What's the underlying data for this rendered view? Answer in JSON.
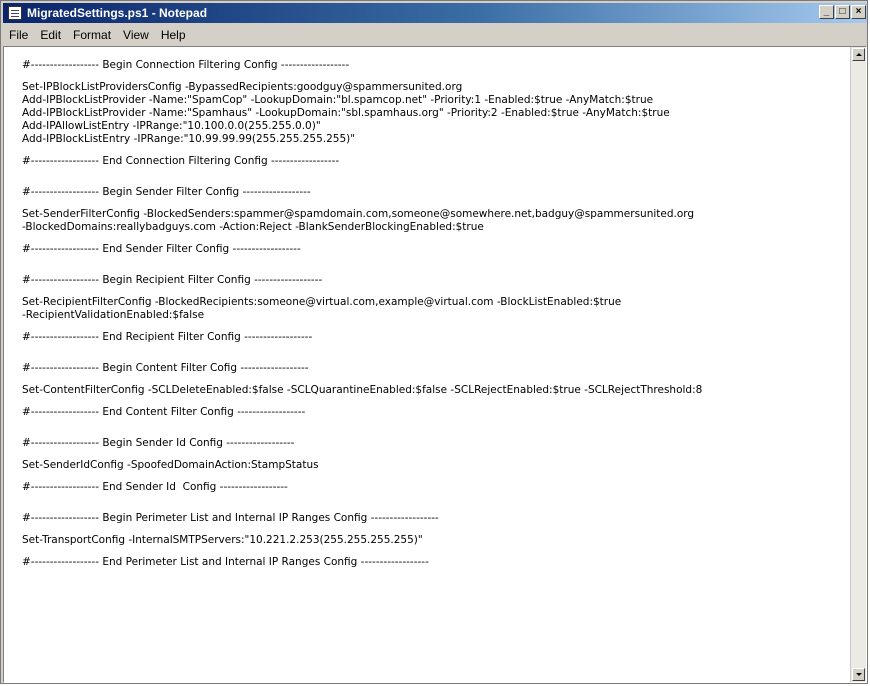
{
  "window": {
    "title": "MigratedSettings.ps1 - Notepad",
    "controls": {
      "minimize": "_",
      "maximize": "□",
      "close": "×"
    }
  },
  "menu": {
    "items": [
      {
        "label": "File"
      },
      {
        "label": "Edit"
      },
      {
        "label": "Format"
      },
      {
        "label": "View"
      },
      {
        "label": "Help"
      }
    ]
  },
  "content": {
    "lines": [
      "#------------------ Begin Connection Filtering Config ------------------",
      "",
      "Set-IPBlockListProvidersConfig -BypassedRecipients:goodguy@spammersunited.org",
      "Add-IPBlockListProvider -Name:\"SpamCop\" -LookupDomain:\"bl.spamcop.net\" -Priority:1 -Enabled:$true -AnyMatch:$true",
      "Add-IPBlockListProvider -Name:\"Spamhaus\" -LookupDomain:\"sbl.spamhaus.org\" -Priority:2 -Enabled:$true -AnyMatch:$true",
      "Add-IPAllowListEntry -IPRange:\"10.100.0.0(255.255.0.0)\"",
      "Add-IPBlockListEntry -IPRange:\"10.99.99.99(255.255.255.255)\"",
      "",
      "#------------------ End Connection Filtering Config ------------------",
      "",
      "",
      "#------------------ Begin Sender Filter Config ------------------",
      "",
      "Set-SenderFilterConfig -BlockedSenders:spammer@spamdomain.com,someone@somewhere.net,badguy@spammersunited.org",
      "-BlockedDomains:reallybadguys.com -Action:Reject -BlankSenderBlockingEnabled:$true",
      "",
      "#------------------ End Sender Filter Config ------------------",
      "",
      "",
      "#------------------ Begin Recipient Filter Config ------------------",
      "",
      "Set-RecipientFilterConfig -BlockedRecipients:someone@virtual.com,example@virtual.com -BlockListEnabled:$true",
      "-RecipientValidationEnabled:$false",
      "",
      "#------------------ End Recipient Filter Config ------------------",
      "",
      "",
      "#------------------ Begin Content Filter Cofig ------------------",
      "",
      "Set-ContentFilterConfig -SCLDeleteEnabled:$false -SCLQuarantineEnabled:$false -SCLRejectEnabled:$true -SCLRejectThreshold:8",
      "",
      "#------------------ End Content Filter Config ------------------",
      "",
      "",
      "#------------------ Begin Sender Id Config ------------------",
      "",
      "Set-SenderIdConfig -SpoofedDomainAction:StampStatus",
      "",
      "#------------------ End Sender Id  Config ------------------",
      "",
      "",
      "#------------------ Begin Perimeter List and Internal IP Ranges Config ------------------",
      "",
      "Set-TransportConfig -InternalSMTPServers:\"10.221.2.253(255.255.255.255)\"",
      "",
      "#------------------ End Perimeter List and Internal IP Ranges Config ------------------"
    ]
  }
}
